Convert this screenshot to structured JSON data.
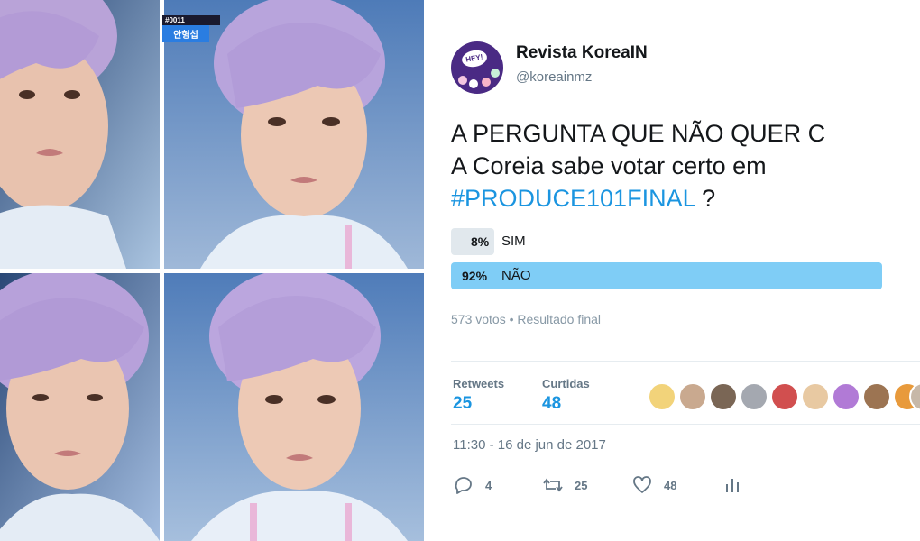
{
  "collage": {
    "caption_code": "#0011",
    "caption_name": "안형섭"
  },
  "tweet": {
    "author_name": "Revista KoreaIN",
    "author_handle": "@koreainmz",
    "avatar_text": "HEY!",
    "text_line1": "A PERGUNTA QUE NÃO QUER C",
    "text_line2": "A Coreia sabe votar certo em",
    "hashtag": "#PRODUCE101FINAL",
    "text_after_hashtag": " ?",
    "poll": {
      "options": [
        {
          "percent_label": "8%",
          "label": "SIM",
          "percent": 8
        },
        {
          "percent_label": "92%",
          "label": "NÃO",
          "percent": 92
        }
      ],
      "summary": "573 votos • Resultado final"
    },
    "stats": {
      "retweets_label": "Retweets",
      "retweets_value": "25",
      "likes_label": "Curtidas",
      "likes_value": "48"
    },
    "timestamp": "11:30 - 16 de jun de 2017",
    "actions": {
      "reply_count": "4",
      "retweet_count": "25",
      "like_count": "48"
    },
    "colors": {
      "accent": "#1b95e0",
      "winning_bar": "#7fcdf6",
      "losing_bar": "#e1e8ed"
    }
  }
}
